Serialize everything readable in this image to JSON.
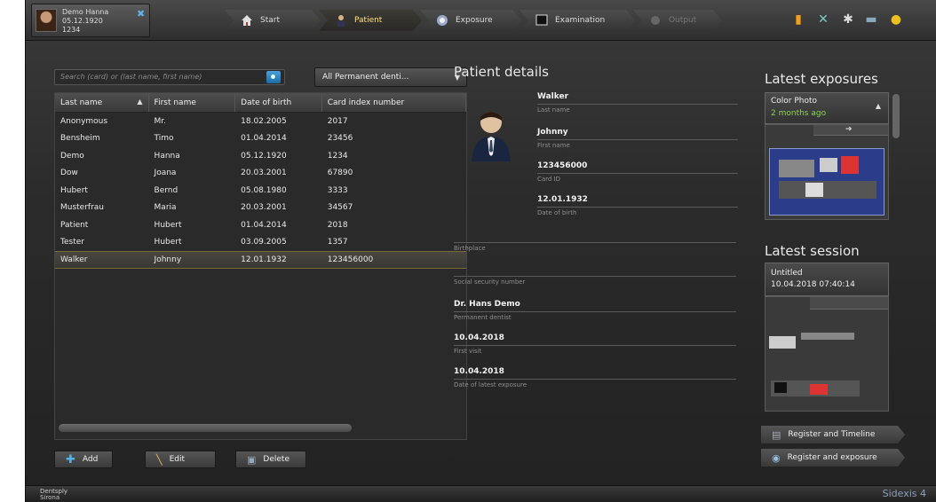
{
  "patient_chip": {
    "name": "Demo Hanna",
    "dob": "05.12.1920",
    "id": "1234"
  },
  "workflow": [
    {
      "label": "Start",
      "icon": "home-icon"
    },
    {
      "label": "Patient",
      "icon": "patient-icon"
    },
    {
      "label": "Exposure",
      "icon": "exposure-icon"
    },
    {
      "label": "Examination",
      "icon": "monitor-icon"
    },
    {
      "label": "Output",
      "icon": "output-icon"
    }
  ],
  "search": {
    "placeholder": "Search (card) or (last name, first name)"
  },
  "dentist_filter": {
    "selected": "All Permanent denti..."
  },
  "table": {
    "headers": [
      "Last name",
      "First name",
      "Date of birth",
      "Card index number"
    ],
    "rows": [
      [
        "Anonymous",
        "Mr.",
        "18.02.2005",
        "2017"
      ],
      [
        "Bensheim",
        "Timo",
        "01.04.2014",
        "23456"
      ],
      [
        "Demo",
        "Hanna",
        "05.12.1920",
        "1234"
      ],
      [
        "Dow",
        "Joana",
        "20.03.2001",
        "67890"
      ],
      [
        "Hubert",
        "Bernd",
        "05.08.1980",
        "3333"
      ],
      [
        "Musterfrau",
        "Maria",
        "20.03.2001",
        "34567"
      ],
      [
        "Patient",
        "Hubert",
        "01.04.2014",
        "2018"
      ],
      [
        "Tester",
        "Hubert",
        "03.09.2005",
        "1357"
      ],
      [
        "Walker",
        "Johnny",
        "12.01.1932",
        "123456000"
      ]
    ],
    "selected_row": 8
  },
  "actions": {
    "add": "Add",
    "edit": "Edit",
    "delete": "Delete"
  },
  "details": {
    "title": "Patient details",
    "last_name": {
      "value": "Walker",
      "label": "Last name"
    },
    "first_name": {
      "value": "Johnny",
      "label": "First name"
    },
    "card_id": {
      "value": "123456000",
      "label": "Card ID"
    },
    "dob": {
      "value": "12.01.1932",
      "label": "Date of birth"
    },
    "birthplace": {
      "value": "",
      "label": "Birthplace"
    },
    "ssn": {
      "value": "",
      "label": "Social security number"
    },
    "dentist": {
      "value": "Dr. Hans Demo",
      "label": "Permanent dentist"
    },
    "first_visit": {
      "value": "10.04.2018",
      "label": "First visit"
    },
    "latest_exposure": {
      "value": "10.04.2018",
      "label": "Date of latest exposure"
    }
  },
  "latest_exposures": {
    "title": "Latest exposures",
    "item_title": "Color Photo",
    "item_time": "2 months ago"
  },
  "latest_session": {
    "title": "Latest session",
    "name": "Untitled",
    "datetime": "10.04.2018 07:40:14"
  },
  "right_buttons": {
    "timeline": "Register and Timeline",
    "exposure": "Register and exposure"
  },
  "footer": {
    "brand_line1": "Dentsply",
    "brand_line2": "Sirona",
    "product": "Sidexis 4"
  },
  "colors": {
    "accent_yellow": "#ffe07a",
    "accent_blue": "#4aa0d8",
    "time_green": "#8fd14f"
  }
}
